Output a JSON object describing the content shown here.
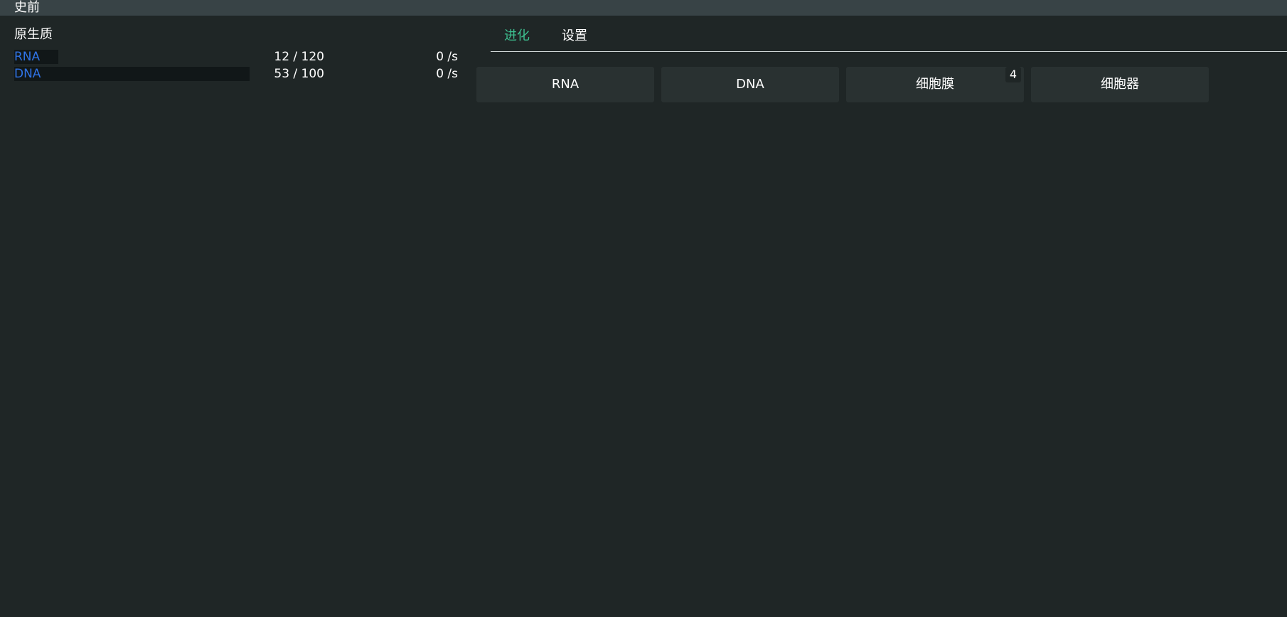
{
  "era": {
    "title": "史前"
  },
  "resources": {
    "category": "原生质",
    "items": [
      {
        "name": "RNA",
        "amount": "12 / 120",
        "rate": "0 /s",
        "fill_fraction": 0.1
      },
      {
        "name": "DNA",
        "amount": "53 / 100",
        "rate": "0 /s",
        "fill_fraction": 0.53
      }
    ]
  },
  "tabs": [
    {
      "label": "进化",
      "active": true
    },
    {
      "label": "设置",
      "active": false
    }
  ],
  "actions": [
    {
      "label": "RNA",
      "badge": ""
    },
    {
      "label": "DNA",
      "badge": ""
    },
    {
      "label": "细胞膜",
      "badge": "4"
    },
    {
      "label": "细胞器",
      "badge": ""
    }
  ],
  "colors": {
    "background": "#1f2626",
    "era_bar": "#384346",
    "resource_name": "#2f73e6",
    "active_tab": "#3dbf8f",
    "button_bg": "#293131"
  }
}
